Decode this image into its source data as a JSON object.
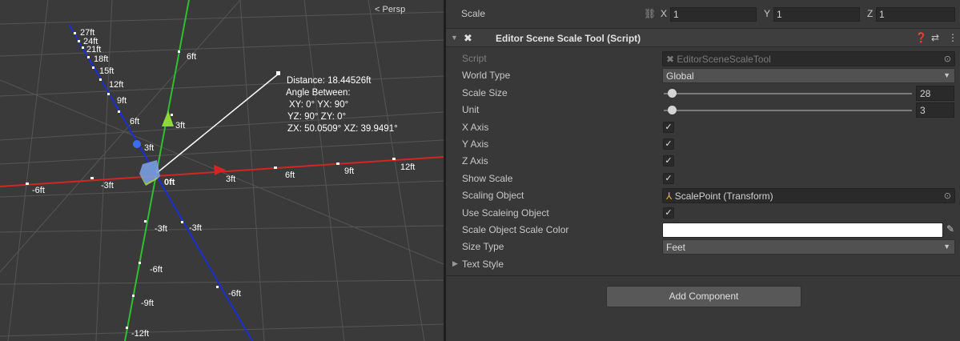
{
  "scene": {
    "view_mode": "< Persp",
    "measurement": {
      "distance": "Distance: 18.44526ft",
      "angle_heading": "Angle Between:",
      "xy_yx": "XY: 0° YX: 90°",
      "yz_zy": "YZ: 90° ZY: 0°",
      "zx_xz": "ZX: 50.0509° XZ: 39.9491°"
    },
    "z_axis_ticks": [
      "27ft",
      "24ft",
      "21ft",
      "18ft",
      "15ft",
      "12ft",
      "9ft",
      "6ft",
      "3ft",
      "-3ft",
      "-6ft"
    ],
    "y_axis_ticks": [
      "6ft",
      "3ft",
      "-3ft",
      "-6ft",
      "-9ft",
      "-12ft"
    ],
    "x_axis_ticks": [
      "-6ft",
      "-3ft",
      "0ft",
      "3ft",
      "6ft",
      "9ft",
      "12ft"
    ],
    "colors": {
      "x_axis": "#d42525",
      "y_axis": "#2fbf2f",
      "z_axis": "#1a2fd6",
      "background": "#3a3a3a",
      "grid": "#555555"
    }
  },
  "inspector": {
    "scale": {
      "label": "Scale",
      "x_label": "X",
      "x": "1",
      "y_label": "Y",
      "y": "1",
      "z_label": "Z",
      "z": "1"
    },
    "component": {
      "title": "Editor Scene Scale Tool (Script)",
      "script_label": "Script",
      "script_value": "EditorSceneScaleTool",
      "world_type_label": "World Type",
      "world_type_value": "Global",
      "scale_size_label": "Scale Size",
      "scale_size_value": "28",
      "unit_label": "Unit",
      "unit_value": "3",
      "x_axis_label": "X Axis",
      "y_axis_label": "Y Axis",
      "z_axis_label": "Z Axis",
      "show_scale_label": "Show Scale",
      "scaling_object_label": "Scaling Object",
      "scaling_object_value": "ScalePoint (Transform)",
      "use_scaling_object_label": "Use Scaleing Object",
      "scale_object_color_label": "Scale Object Scale Color",
      "scale_object_color": "#ffffff",
      "size_type_label": "Size Type",
      "size_type_value": "Feet",
      "text_style_label": "Text Style"
    },
    "add_component_label": "Add Component"
  }
}
